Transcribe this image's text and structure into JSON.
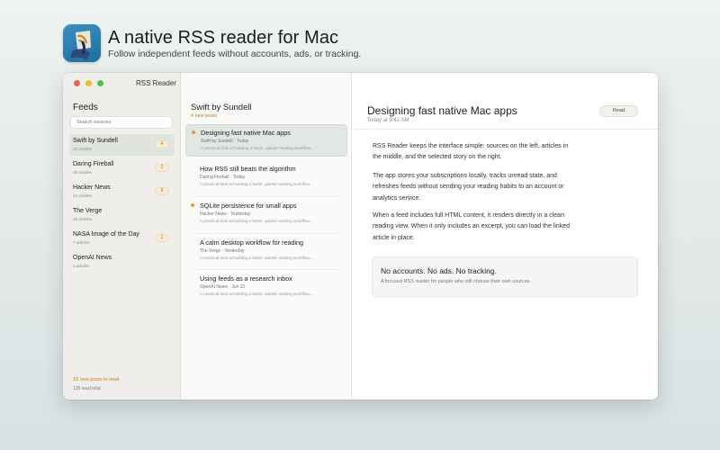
{
  "hero": {
    "title": "A native RSS reader for Mac",
    "subtitle": "Follow independent feeds without accounts, ads, or tracking."
  },
  "window": {
    "title": "RSS Reader"
  },
  "sidebar": {
    "header": "Feeds",
    "search_placeholder": "Search sources",
    "feeds": [
      {
        "name": "Swift by Sundell",
        "count": "12 articles",
        "badge": "4",
        "selected": true
      },
      {
        "name": "Daring Fireball",
        "count": "28 articles",
        "badge": "2",
        "selected": false
      },
      {
        "name": "Hacker News",
        "count": "42 articles",
        "badge": "8",
        "selected": false
      },
      {
        "name": "The Verge",
        "count": "18 articles",
        "badge": "",
        "selected": false
      },
      {
        "name": "NASA Image of the Day",
        "count": "7 articles",
        "badge": "1",
        "selected": false
      },
      {
        "name": "OpenAI News",
        "count": "6 articles",
        "badge": "",
        "selected": false
      }
    ],
    "footer_new": "16 new posts to read",
    "footer_total": "126 read total"
  },
  "list": {
    "title": "Swift by Sundell",
    "subtitle": "4 new posts",
    "articles": [
      {
        "title": "Designing fast native Mac apps",
        "meta": "Swift by Sundell · Today",
        "excerpt": "A practical look at building a faster, quieter reading workflow...",
        "unread": true,
        "selected": true
      },
      {
        "title": "How RSS still beats the algorithm",
        "meta": "Daring Fireball · Today",
        "excerpt": "A practical look at building a faster, quieter reading workflow...",
        "unread": false,
        "selected": false
      },
      {
        "title": "SQLite persistence for small apps",
        "meta": "Hacker News · Yesterday",
        "excerpt": "A practical look at building a faster, quieter reading workflow...",
        "unread": true,
        "selected": false
      },
      {
        "title": "A calm desktop workflow for reading",
        "meta": "The Verge · Yesterday",
        "excerpt": "A practical look at building a faster, quieter reading workflow...",
        "unread": false,
        "selected": false
      },
      {
        "title": "Using feeds as a research inbox",
        "meta": "OpenAI News · Jun 22",
        "excerpt": "A practical look at building a faster, quieter reading workflow...",
        "unread": false,
        "selected": false
      }
    ]
  },
  "reader": {
    "title": "Designing fast native Mac apps",
    "date": "Today at 9:42 AM",
    "button": "Read",
    "paragraphs": [
      "RSS Reader keeps the interface simple: sources on the left, articles in the middle, and the selected story on the right.",
      "The app stores your subscriptions locally, tracks unread state, and refreshes feeds without sending your reading habits to an account or analytics service.",
      "When a feed includes full HTML content, it renders directly in a clean reading view. When it only includes an excerpt, you can load the linked article in place."
    ],
    "callout_title": "No accounts. No ads. No tracking.",
    "callout_sub": "A focused RSS reader for people who still choose their own sources."
  },
  "colors": {
    "accent": "#ef9b32",
    "selection": "#dfe4df",
    "icon": "#2a84b4"
  },
  "icons": [
    "app-icon",
    "unread-dot-icon"
  ]
}
